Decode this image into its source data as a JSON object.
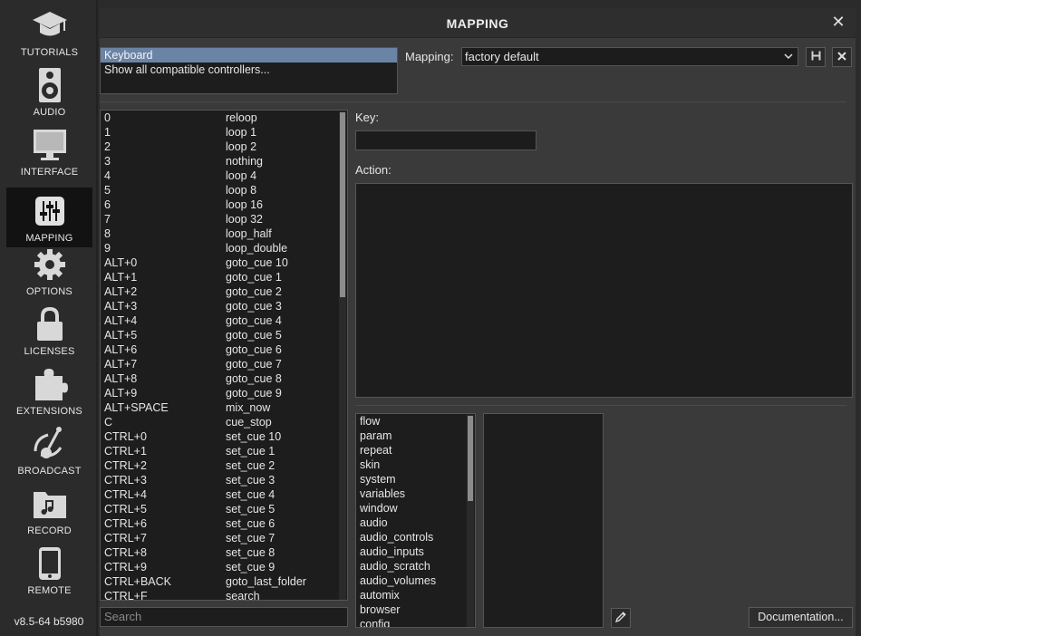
{
  "sidebar": {
    "items": [
      {
        "label": "TUTORIALS",
        "icon": "graduation-cap-icon"
      },
      {
        "label": "AUDIO",
        "icon": "speaker-icon"
      },
      {
        "label": "INTERFACE",
        "icon": "monitor-icon"
      },
      {
        "label": "MAPPING",
        "icon": "sliders-icon"
      },
      {
        "label": "OPTIONS",
        "icon": "gear-icon"
      },
      {
        "label": "LICENSES",
        "icon": "lock-icon"
      },
      {
        "label": "EXTENSIONS",
        "icon": "puzzle-icon"
      },
      {
        "label": "BROADCAST",
        "icon": "broadcast-icon"
      },
      {
        "label": "RECORD",
        "icon": "music-folder-icon"
      },
      {
        "label": "REMOTE",
        "icon": "phone-icon"
      }
    ],
    "active": "MAPPING",
    "version": "v8.5-64 b5980"
  },
  "dialog": {
    "title": "MAPPING",
    "close_glyph": "✕"
  },
  "devices": {
    "items": [
      "Keyboard",
      "Show all compatible controllers..."
    ],
    "selected": "Keyboard"
  },
  "mapping": {
    "label": "Mapping:",
    "value": "factory default"
  },
  "key_list": {
    "rows": [
      {
        "key": "0",
        "action": "reloop"
      },
      {
        "key": "1",
        "action": "loop 1"
      },
      {
        "key": "2",
        "action": "loop 2"
      },
      {
        "key": "3",
        "action": "nothing"
      },
      {
        "key": "4",
        "action": "loop 4"
      },
      {
        "key": "5",
        "action": "loop 8"
      },
      {
        "key": "6",
        "action": "loop 16"
      },
      {
        "key": "7",
        "action": "loop 32"
      },
      {
        "key": "8",
        "action": "loop_half"
      },
      {
        "key": "9",
        "action": "loop_double"
      },
      {
        "key": "ALT+0",
        "action": "goto_cue 10"
      },
      {
        "key": "ALT+1",
        "action": "goto_cue 1"
      },
      {
        "key": "ALT+2",
        "action": "goto_cue 2"
      },
      {
        "key": "ALT+3",
        "action": "goto_cue 3"
      },
      {
        "key": "ALT+4",
        "action": "goto_cue 4"
      },
      {
        "key": "ALT+5",
        "action": "goto_cue 5"
      },
      {
        "key": "ALT+6",
        "action": "goto_cue 6"
      },
      {
        "key": "ALT+7",
        "action": "goto_cue 7"
      },
      {
        "key": "ALT+8",
        "action": "goto_cue 8"
      },
      {
        "key": "ALT+9",
        "action": "goto_cue 9"
      },
      {
        "key": "ALT+SPACE",
        "action": "mix_now"
      },
      {
        "key": "C",
        "action": "cue_stop"
      },
      {
        "key": "CTRL+0",
        "action": "set_cue 10"
      },
      {
        "key": "CTRL+1",
        "action": "set_cue 1"
      },
      {
        "key": "CTRL+2",
        "action": "set_cue 2"
      },
      {
        "key": "CTRL+3",
        "action": "set_cue 3"
      },
      {
        "key": "CTRL+4",
        "action": "set_cue 4"
      },
      {
        "key": "CTRL+5",
        "action": "set_cue 5"
      },
      {
        "key": "CTRL+6",
        "action": "set_cue 6"
      },
      {
        "key": "CTRL+7",
        "action": "set_cue 7"
      },
      {
        "key": "CTRL+8",
        "action": "set_cue 8"
      },
      {
        "key": "CTRL+9",
        "action": "set_cue 9"
      },
      {
        "key": "CTRL+BACK",
        "action": "goto_last_folder"
      },
      {
        "key": "CTRL+F",
        "action": "search"
      }
    ]
  },
  "search": {
    "placeholder": "Search"
  },
  "key_field": {
    "label": "Key:",
    "value": ""
  },
  "action_field": {
    "label": "Action:",
    "value": ""
  },
  "categories": {
    "items": [
      "flow",
      "param",
      "repeat",
      "skin",
      "system",
      "variables",
      "window",
      "audio",
      "audio_controls",
      "audio_inputs",
      "audio_scratch",
      "audio_volumes",
      "automix",
      "browser",
      "config"
    ]
  },
  "documentation_button": "Documentation..."
}
